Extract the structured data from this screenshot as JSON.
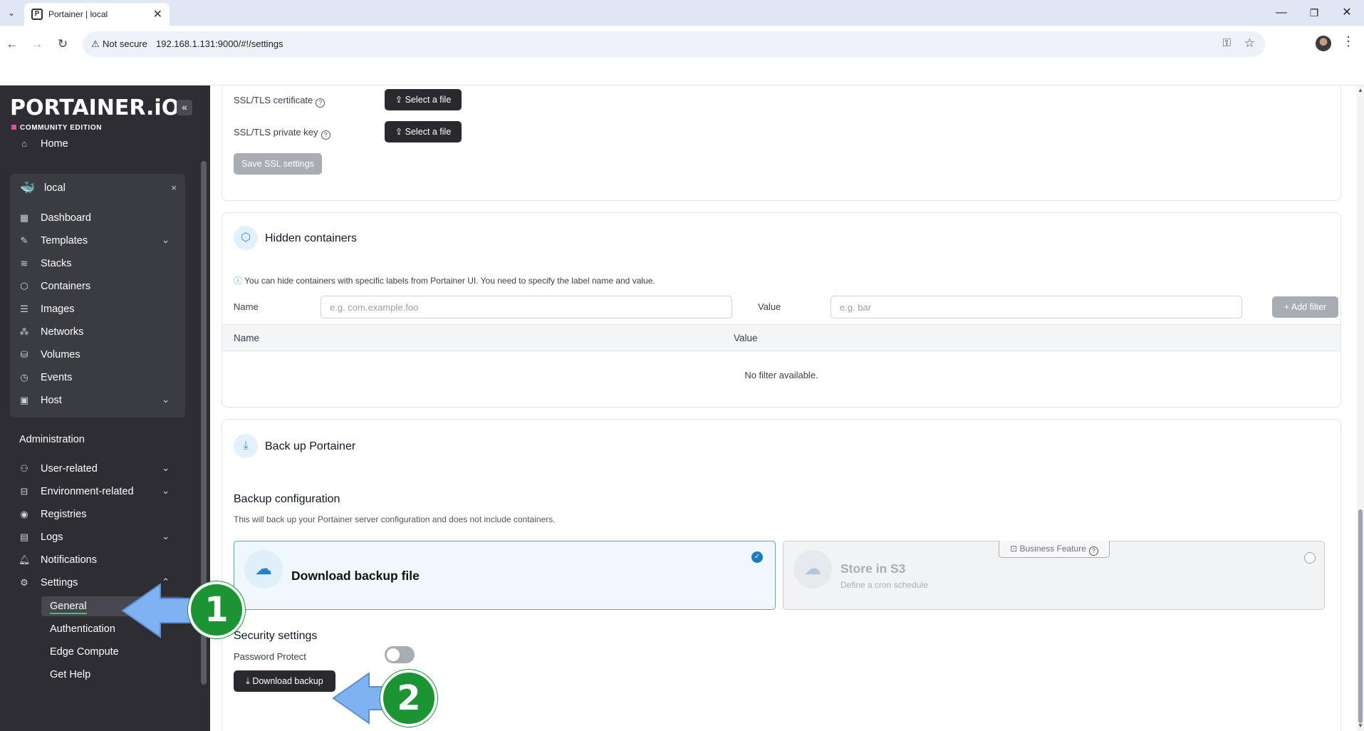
{
  "browser": {
    "tab_title": "Portainer | local",
    "not_secure": "Not secure",
    "url": "192.168.1.131:9000/#!/settings",
    "win_minimize": "—",
    "win_restore": "❐",
    "win_close": "✕"
  },
  "sidebar": {
    "logo": "PORTAINER.iO",
    "edition": "COMMUNITY EDITION",
    "collapse": "«",
    "home": "Home",
    "environment": {
      "name": "local",
      "close": "×"
    },
    "env_items": [
      {
        "label": "Dashboard"
      },
      {
        "label": "Templates"
      },
      {
        "label": "Stacks"
      },
      {
        "label": "Containers"
      },
      {
        "label": "Images"
      },
      {
        "label": "Networks"
      },
      {
        "label": "Volumes"
      },
      {
        "label": "Events"
      },
      {
        "label": "Host"
      }
    ],
    "administration": "Administration",
    "admin_items": [
      {
        "label": "User-related"
      },
      {
        "label": "Environment-related"
      },
      {
        "label": "Registries"
      },
      {
        "label": "Logs"
      },
      {
        "label": "Notifications"
      },
      {
        "label": "Settings"
      }
    ],
    "settings_sub": [
      {
        "label": "General"
      },
      {
        "label": "Authentication"
      },
      {
        "label": "Edge Compute"
      },
      {
        "label": "Get Help"
      }
    ]
  },
  "ssl": {
    "cert_label": "SSL/TLS certificate",
    "key_label": "SSL/TLS private key",
    "select_file": "Select a file",
    "save_btn": "Save SSL settings"
  },
  "hidden_containers": {
    "title": "Hidden containers",
    "info": "You can hide containers with specific labels from Portainer UI. You need to specify the label name and value.",
    "name_label": "Name",
    "name_placeholder": "e.g. com.example.foo",
    "value_label": "Value",
    "value_placeholder": "e.g. bar",
    "add_filter": "+ Add filter",
    "col_name": "Name",
    "col_value": "Value",
    "empty": "No filter available."
  },
  "backup": {
    "title": "Back up Portainer",
    "config_title": "Backup configuration",
    "config_desc": "This will back up your Portainer server configuration and does not include containers.",
    "option_download": "Download backup file",
    "option_s3": "Store in S3",
    "option_s3_sub": "Define a cron schedule",
    "business_badge": "Business Feature",
    "security_title": "Security settings",
    "password_protect": "Password Protect",
    "download_btn": "Download backup"
  },
  "annotations": {
    "step1": "1",
    "step2": "2"
  },
  "colors": {
    "accent": "#3b8fd1",
    "callout_green": "#1c9434",
    "callout_arrow": "#7fb2f0",
    "sidebar_bg": "#2d2d33"
  }
}
